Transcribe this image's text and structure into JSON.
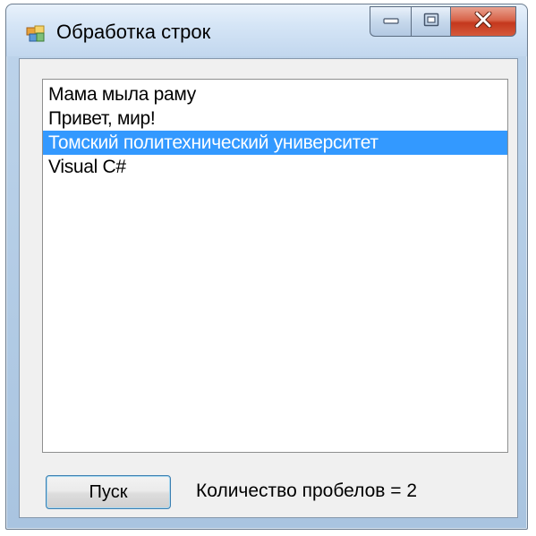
{
  "window": {
    "title": "Обработка строк",
    "icons": {
      "app": "app-window-icon",
      "minimize": "minimize-icon",
      "maximize": "maximize-icon",
      "close": "close-icon"
    }
  },
  "listbox": {
    "items": [
      {
        "text": "Мама мыла раму",
        "selected": false
      },
      {
        "text": "Привет, мир!",
        "selected": false
      },
      {
        "text": "Томский политехнический университет",
        "selected": true
      },
      {
        "text": "Visual C#",
        "selected": false
      }
    ]
  },
  "button": {
    "label": "Пуск"
  },
  "status": {
    "text": "Количество пробелов = 2"
  },
  "colors": {
    "selection": "#3399ff",
    "close_button": "#c4381d",
    "client_background": "#f0f0f0"
  }
}
